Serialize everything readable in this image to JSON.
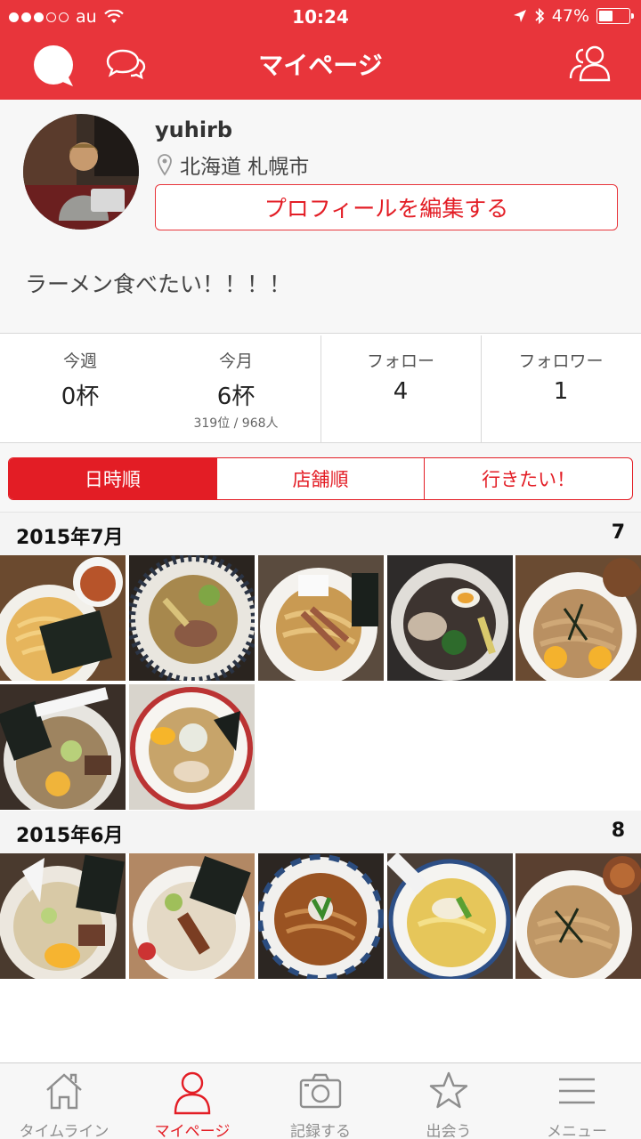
{
  "status_bar": {
    "carrier": "au",
    "time": "10:24",
    "battery": "47%",
    "battery_level": 0.47
  },
  "nav": {
    "title": "マイページ",
    "left_icons": [
      "chat-bubble-icon",
      "messages-icon"
    ],
    "right_icon": "users-icon"
  },
  "profile": {
    "username": "yuhirb",
    "location": "北海道 札幌市",
    "edit_button": "プロフィールを編集する",
    "bio": "ラーメン食べたい！！！！"
  },
  "stats": {
    "this_week_label": "今週",
    "this_week_value": "0杯",
    "this_month_label": "今月",
    "this_month_value": "6杯",
    "rank": "319位 / 968人",
    "follow_label": "フォロー",
    "follow_value": "4",
    "follower_label": "フォロワー",
    "follower_value": "1"
  },
  "tabs": [
    {
      "label": "日時順",
      "active": true
    },
    {
      "label": "店舗順",
      "active": false
    },
    {
      "label": "行きたい！",
      "active": false
    }
  ],
  "sections": [
    {
      "month": "2015年7月",
      "count": "7"
    },
    {
      "month": "2015年6月",
      "count": "8"
    }
  ],
  "tab_bar": [
    {
      "label": "タイムライン",
      "icon": "home-icon",
      "active": false
    },
    {
      "label": "マイページ",
      "icon": "person-icon",
      "active": true
    },
    {
      "label": "記録する",
      "icon": "camera-icon",
      "active": false
    },
    {
      "label": "出会う",
      "icon": "star-icon",
      "active": false
    },
    {
      "label": "メニュー",
      "icon": "menu-icon",
      "active": false
    }
  ],
  "colors": {
    "brand_red": "#e8353b",
    "accent_red": "#e31d25",
    "inactive_gray": "#8e8e8e"
  }
}
